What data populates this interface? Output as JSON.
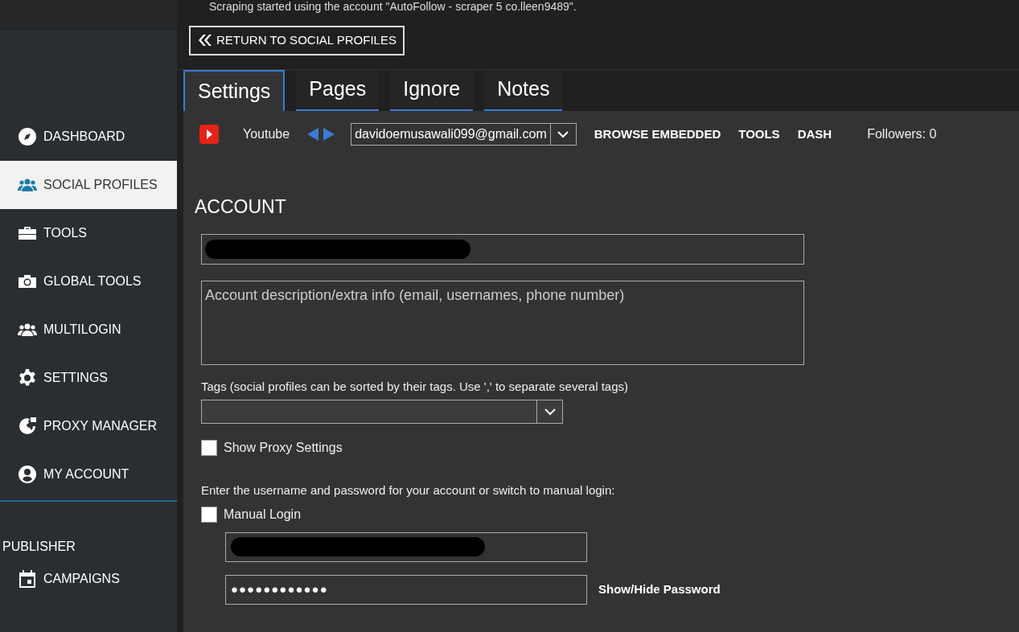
{
  "notice": "Scraping started using the account \"AutoFollow - scraper 5 co.lleen9489\".",
  "return_button": "RETURN TO SOCIAL PROFILES",
  "sidebar": {
    "items": [
      {
        "label": "DASHBOARD",
        "selected": false
      },
      {
        "label": "SOCIAL PROFILES",
        "selected": true
      },
      {
        "label": "TOOLS",
        "selected": false
      },
      {
        "label": "GLOBAL TOOLS",
        "selected": false
      },
      {
        "label": "MULTILOGIN",
        "selected": false
      },
      {
        "label": "SETTINGS",
        "selected": false
      },
      {
        "label": "PROXY MANAGER",
        "selected": false
      },
      {
        "label": "MY ACCOUNT",
        "selected": false
      }
    ],
    "section": "PUBLISHER",
    "section_items": [
      {
        "label": "CAMPAIGNS",
        "selected": false
      }
    ]
  },
  "tabs": [
    {
      "label": "Settings",
      "selected": true
    },
    {
      "label": "Pages",
      "selected": false
    },
    {
      "label": "Ignore",
      "selected": false
    },
    {
      "label": "Notes",
      "selected": false
    }
  ],
  "toolbar": {
    "network": "Youtube",
    "account": "davidoemusawali099@gmail.com",
    "links": [
      "BROWSE EMBEDDED",
      "TOOLS",
      "DASH"
    ],
    "followers": "Followers: 0"
  },
  "account": {
    "heading": "ACCOUNT",
    "description_placeholder": "Account description/extra info (email, usernames, phone number)",
    "tags_label": "Tags (social profiles can be sorted by their tags. Use ',' to separate several tags)",
    "show_proxy": {
      "label": "Show Proxy Settings",
      "checked": false
    },
    "login_hint": "Enter the username and password for your account or switch to manual login:",
    "manual_login": {
      "label": "Manual Login",
      "checked": false
    },
    "password": "●●●●●●●●●●●●",
    "show_hide": "Show/Hide Password"
  }
}
